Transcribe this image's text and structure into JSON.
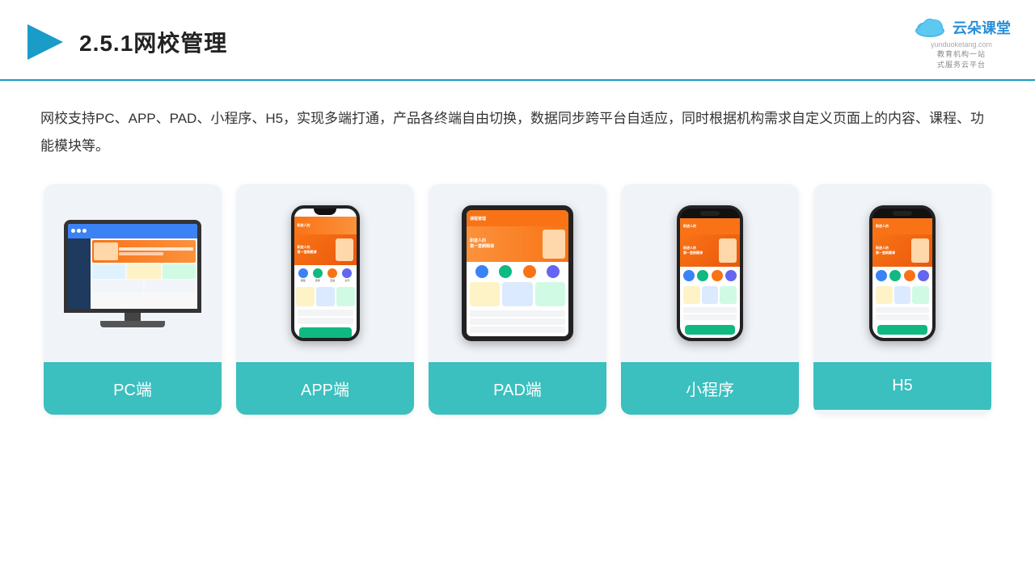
{
  "header": {
    "title": "2.5.1网校管理",
    "logo_name": "云朵课堂",
    "logo_url": "yunduoketang.com",
    "logo_slogan": "教育机构一站\n式服务云平台"
  },
  "description": "网校支持PC、APP、PAD、小程序、H5，实现多端打通，产品各终端自由切换，数据同步跨平台自适应，同时根据机构需求自定义页面上的内容、课程、功能模块等。",
  "cards": [
    {
      "id": "pc",
      "label": "PC端"
    },
    {
      "id": "app",
      "label": "APP端"
    },
    {
      "id": "pad",
      "label": "PAD端"
    },
    {
      "id": "mini-program",
      "label": "小程序"
    },
    {
      "id": "h5",
      "label": "H5"
    }
  ],
  "accent_color": "#3bbfbf"
}
